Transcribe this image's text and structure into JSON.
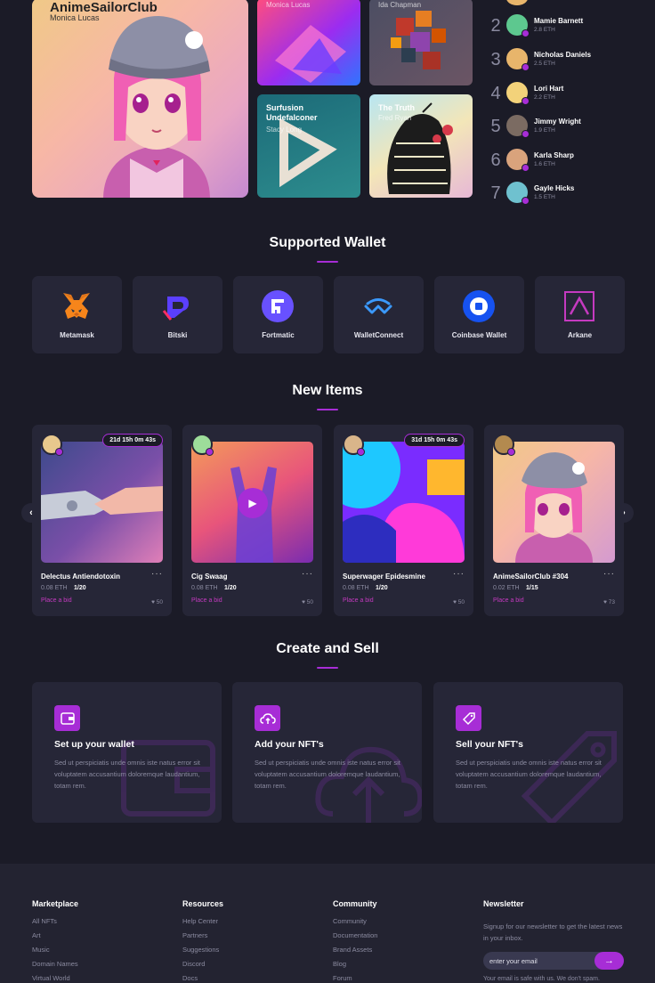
{
  "hero": {
    "featured": {
      "title": "AnimeSailorClub",
      "creator": "Monica Lucas"
    },
    "tiles": [
      {
        "title": "",
        "creator": "Monica Lucas"
      },
      {
        "title": "",
        "creator": "Ida Chapman"
      },
      {
        "title": "Surfusion Undefalconer",
        "creator": "Stacy Long"
      },
      {
        "title": "The Truth",
        "creator": "Fred Ryan"
      }
    ]
  },
  "ranking": [
    {
      "rank": "2",
      "name": "Mamie Barnett",
      "eth": "2.8 ETH",
      "color": "#5dc88f"
    },
    {
      "rank": "3",
      "name": "Nicholas Daniels",
      "eth": "2.5 ETH",
      "color": "#e8b56b"
    },
    {
      "rank": "4",
      "name": "Lori Hart",
      "eth": "2.2 ETH",
      "color": "#f3d27a"
    },
    {
      "rank": "5",
      "name": "Jimmy Wright",
      "eth": "1.9 ETH",
      "color": "#7b6b62"
    },
    {
      "rank": "6",
      "name": "Karla Sharp",
      "eth": "1.6 ETH",
      "color": "#d9a37c"
    },
    {
      "rank": "7",
      "name": "Gayle Hicks",
      "eth": "1.5 ETH",
      "color": "#6fc1cf"
    }
  ],
  "wallet_section": {
    "title": "Supported Wallet"
  },
  "wallets": [
    {
      "label": "Metamask"
    },
    {
      "label": "Bitski"
    },
    {
      "label": "Fortmatic"
    },
    {
      "label": "WalletConnect"
    },
    {
      "label": "Coinbase Wallet"
    },
    {
      "label": "Arkane"
    }
  ],
  "new_items": {
    "title": "New Items",
    "prev_icon": "chevron-left-icon",
    "next_icon": "chevron-right-icon",
    "items": [
      {
        "title": "Delectus Antiendotoxin",
        "price": "0.08 ETH",
        "count": "1/20",
        "bid": "Place a bid",
        "likes": "50",
        "timer": "21d 15h 0m 43s"
      },
      {
        "title": "Cig Swaag",
        "price": "0.08 ETH",
        "count": "1/20",
        "bid": "Place a bid",
        "likes": "50"
      },
      {
        "title": "Superwager Epidesmine",
        "price": "0.08 ETH",
        "count": "1/20",
        "bid": "Place a bid",
        "likes": "50",
        "timer": "31d 15h 0m 43s"
      },
      {
        "title": "AnimeSailorClub #304",
        "price": "0.02 ETH",
        "count": "1/15",
        "bid": "Place a bid",
        "likes": "73"
      }
    ]
  },
  "create_section": {
    "title": "Create and Sell",
    "steps": [
      {
        "title": "Set up your wallet",
        "text": "Sed ut perspiciatis unde omnis iste natus error sit voluptatem accusantium doloremque laudantium, totam rem."
      },
      {
        "title": "Add your NFT's",
        "text": "Sed ut perspiciatis unde omnis iste natus error sit voluptatem accusantium doloremque laudantium, totam rem."
      },
      {
        "title": "Sell your NFT's",
        "text": "Sed ut perspiciatis unde omnis iste natus error sit voluptatem accusantium doloremque laudantium, totam rem."
      }
    ]
  },
  "footer": {
    "marketplace": {
      "heading": "Marketplace",
      "links": [
        "All NFTs",
        "Art",
        "Music",
        "Domain Names",
        "Virtual World"
      ]
    },
    "resources": {
      "heading": "Resources",
      "links": [
        "Help Center",
        "Partners",
        "Suggestions",
        "Discord",
        "Docs"
      ]
    },
    "community": {
      "heading": "Community",
      "links": [
        "Community",
        "Documentation",
        "Brand Assets",
        "Blog",
        "Forum"
      ]
    },
    "newsletter": {
      "heading": "Newsletter",
      "text": "Signup for our newsletter to get the latest news in your inbox.",
      "placeholder": "enter your email",
      "note": "Your email is safe with us. We don't spam."
    }
  },
  "colors": {
    "accent": "#a72dd6",
    "background": "#1b1b27",
    "card": "#262637"
  }
}
